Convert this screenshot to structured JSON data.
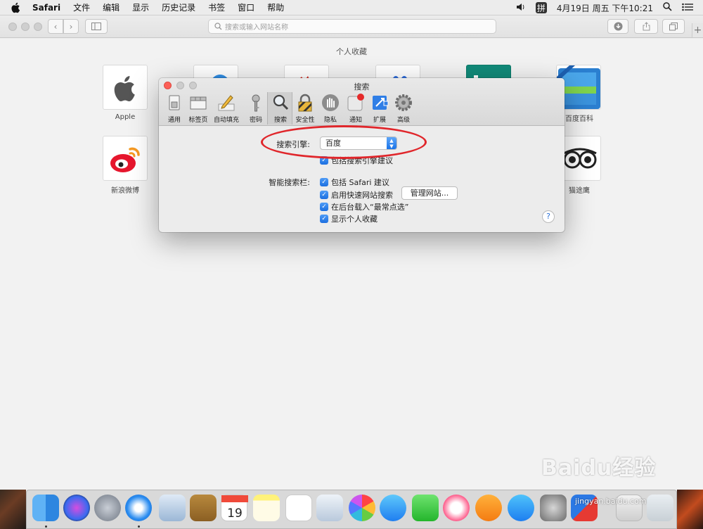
{
  "menubar": {
    "app": "Safari",
    "items": [
      "文件",
      "编辑",
      "显示",
      "历史记录",
      "书签",
      "窗口",
      "帮助"
    ],
    "ime": "拼",
    "datetime": "4月19日 周五 下午10:21"
  },
  "toolbar": {
    "address_placeholder": "搜索或输入网站名称"
  },
  "favorites": {
    "title": "个人收藏",
    "tiles": [
      {
        "label": "Apple"
      },
      {
        "label": "百度百科"
      },
      {
        "label": "新浪微博"
      },
      {
        "label": "猫途鹰"
      }
    ]
  },
  "prefs": {
    "title": "搜索",
    "tabs": [
      {
        "label": "通用",
        "icon": "switch-icon"
      },
      {
        "label": "标签页",
        "icon": "tabs-icon"
      },
      {
        "label": "自动填充",
        "icon": "pencil-icon"
      },
      {
        "label": "密码",
        "icon": "key-icon"
      },
      {
        "label": "搜索",
        "icon": "magnifier-icon",
        "selected": true
      },
      {
        "label": "安全性",
        "icon": "lock-icon"
      },
      {
        "label": "隐私",
        "icon": "hand-icon"
      },
      {
        "label": "通知",
        "icon": "notification-icon"
      },
      {
        "label": "扩展",
        "icon": "extensions-icon"
      },
      {
        "label": "高级",
        "icon": "gear-icon"
      }
    ],
    "search_engine_label": "搜索引擎:",
    "search_engine_value": "百度",
    "include_suggestions": "包括搜索引擎建议",
    "smart_search_label": "智能搜索栏:",
    "smart_options": [
      "包括 Safari 建议",
      "启用快速网站搜索",
      "在后台载入“最常点选”",
      "显示个人收藏"
    ],
    "manage_sites_button": "管理网站...",
    "help": "?"
  },
  "watermark": {
    "logo": "Baidu经验",
    "url": "jingyan.baidu.com"
  },
  "colors": {
    "annotation_red": "#e0262b",
    "checkbox_blue": "#1c6fe0"
  }
}
